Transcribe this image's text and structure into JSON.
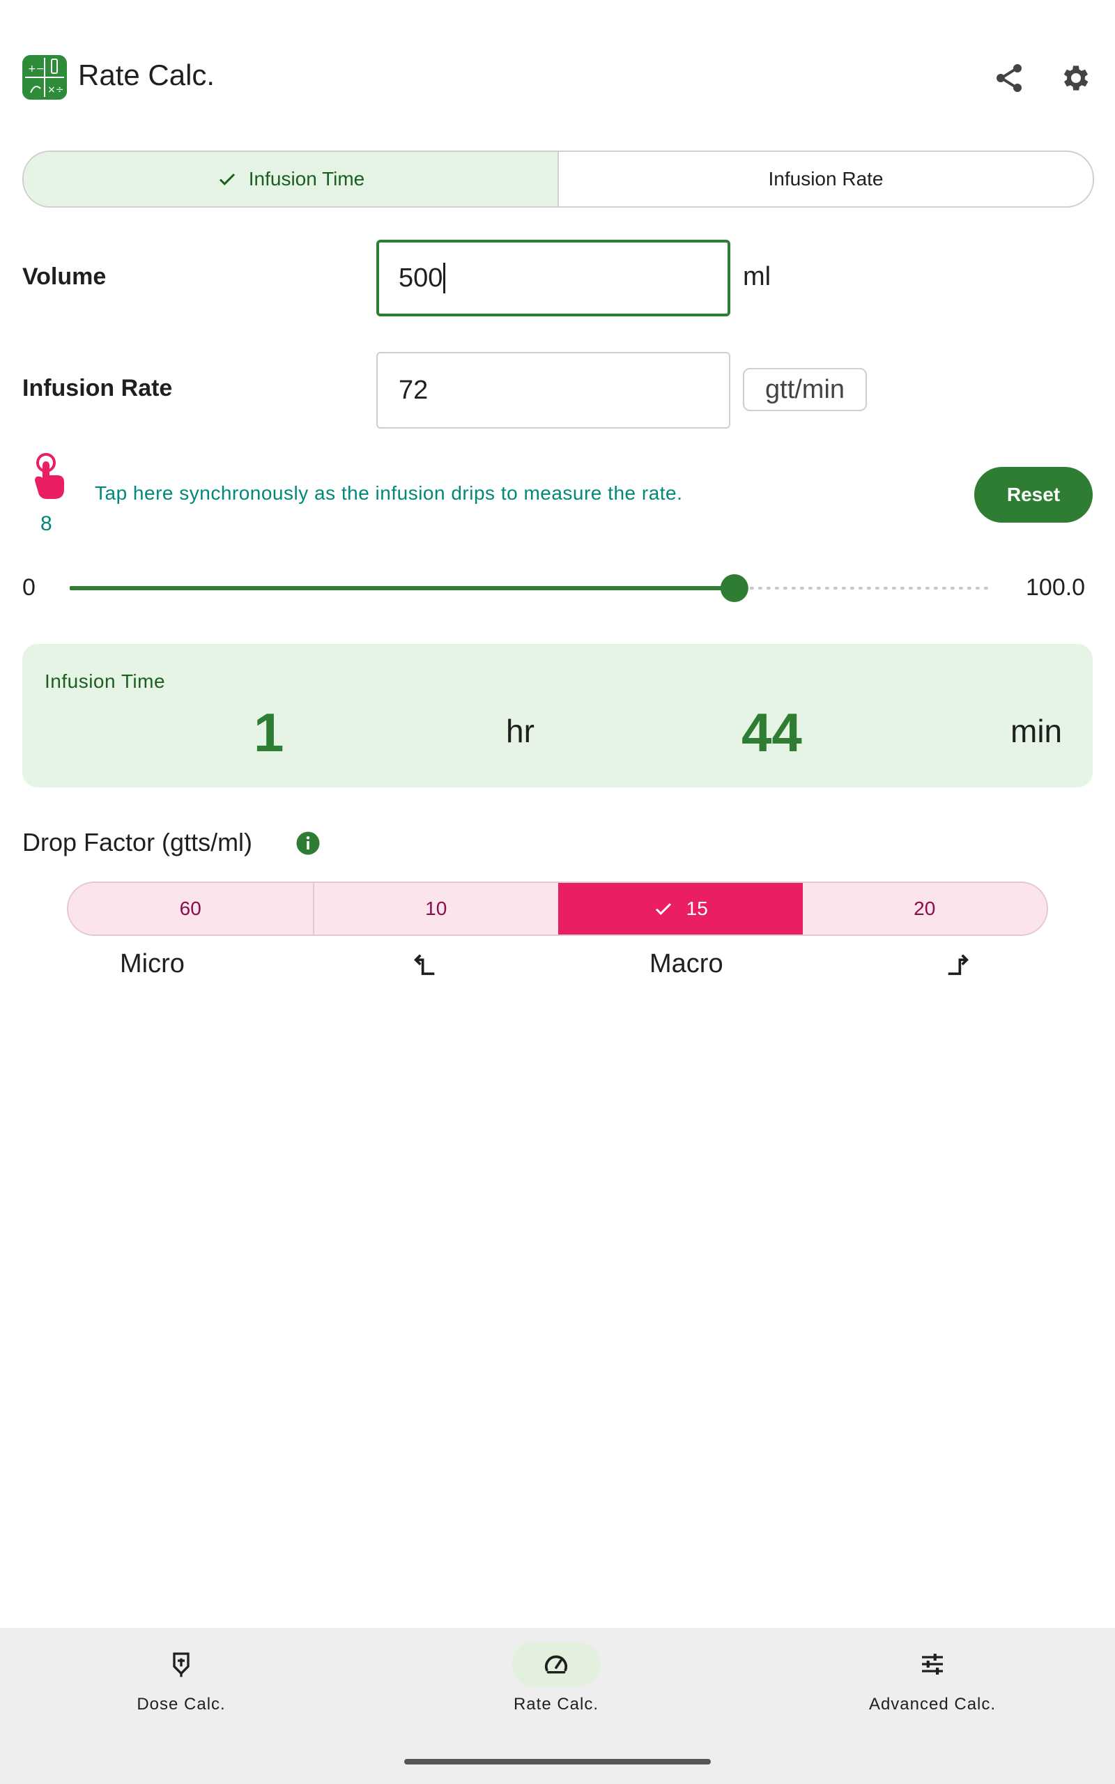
{
  "app": {
    "title": "Rate Calc."
  },
  "icons": {
    "logo": "calculator-app-icon",
    "share": "share-icon",
    "settings": "gear-icon",
    "tap": "tap-hand-icon",
    "info": "info-icon",
    "check": "check-icon"
  },
  "mode_tabs": [
    {
      "label": "Infusion Time",
      "selected": true
    },
    {
      "label": "Infusion Rate",
      "selected": false
    }
  ],
  "form": {
    "volume": {
      "label": "Volume",
      "value": "500",
      "unit": "ml"
    },
    "infusion_rate": {
      "label": "Infusion Rate",
      "value": "72",
      "unit": "gtt/min"
    }
  },
  "tap_counter": {
    "count": "8",
    "hint": "Tap here synchronously as the infusion drips to measure the rate.",
    "reset_label": "Reset"
  },
  "slider": {
    "min_label": "0",
    "max_label": "100.0",
    "value": 72,
    "min": 0,
    "max": 100
  },
  "result": {
    "title": "Infusion Time",
    "hours": "1",
    "hours_unit": "hr",
    "minutes": "44",
    "minutes_unit": "min"
  },
  "drop_factor": {
    "label": "Drop Factor (gtts/ml)",
    "options": [
      {
        "label": "60",
        "selected": false
      },
      {
        "label": "10",
        "selected": false
      },
      {
        "label": "15",
        "selected": true
      },
      {
        "label": "20",
        "selected": false
      }
    ],
    "sub_labels": {
      "micro": "Micro",
      "macro": "Macro"
    }
  },
  "bottom_nav": [
    {
      "label": "Dose Calc.",
      "icon": "dose-calc-icon",
      "selected": false
    },
    {
      "label": "Rate Calc.",
      "icon": "speedometer-icon",
      "selected": true
    },
    {
      "label": "Advanced Calc.",
      "icon": "sliders-icon",
      "selected": false
    }
  ],
  "colors": {
    "primary": "#2e7d32",
    "primary_container": "#e6f4e6",
    "accent": "#e91e63",
    "accent_container": "#fce4ec",
    "teal_text": "#00897b"
  }
}
